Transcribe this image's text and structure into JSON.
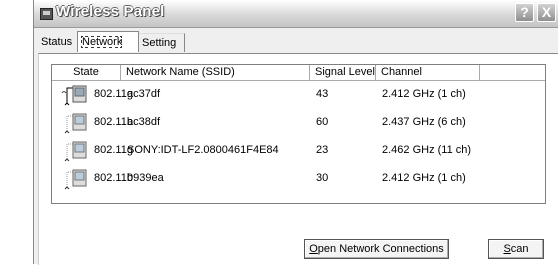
{
  "window": {
    "title": "Wireless Panel",
    "help_glyph": "?",
    "close_glyph": "X"
  },
  "tabs": [
    {
      "label": "Status"
    },
    {
      "label": "Network List"
    },
    {
      "label": "Setting"
    }
  ],
  "list": {
    "columns": [
      "State",
      "Network Name (SSID)",
      "Signal Level",
      "Channel"
    ],
    "rows": [
      {
        "standard": "802.11g",
        "ssid": "ac37df",
        "signal": "43",
        "channel": "2.412 GHz (1 ch)"
      },
      {
        "standard": "802.11b",
        "ssid": "ac38df",
        "signal": "60",
        "channel": "2.437 GHz (6 ch)"
      },
      {
        "standard": "802.11g",
        "ssid": "SONY:IDT-LF2.0800461F4E84",
        "signal": "23",
        "channel": "2.462 GHz (11 ch)"
      },
      {
        "standard": "802.11b",
        "ssid": "0939ea",
        "signal": "30",
        "channel": "2.412 GHz (1 ch)"
      }
    ]
  },
  "buttons": {
    "open_underline": "O",
    "open_rest": "pen Network Connections",
    "scan_underline": "S",
    "scan_rest": "can"
  }
}
